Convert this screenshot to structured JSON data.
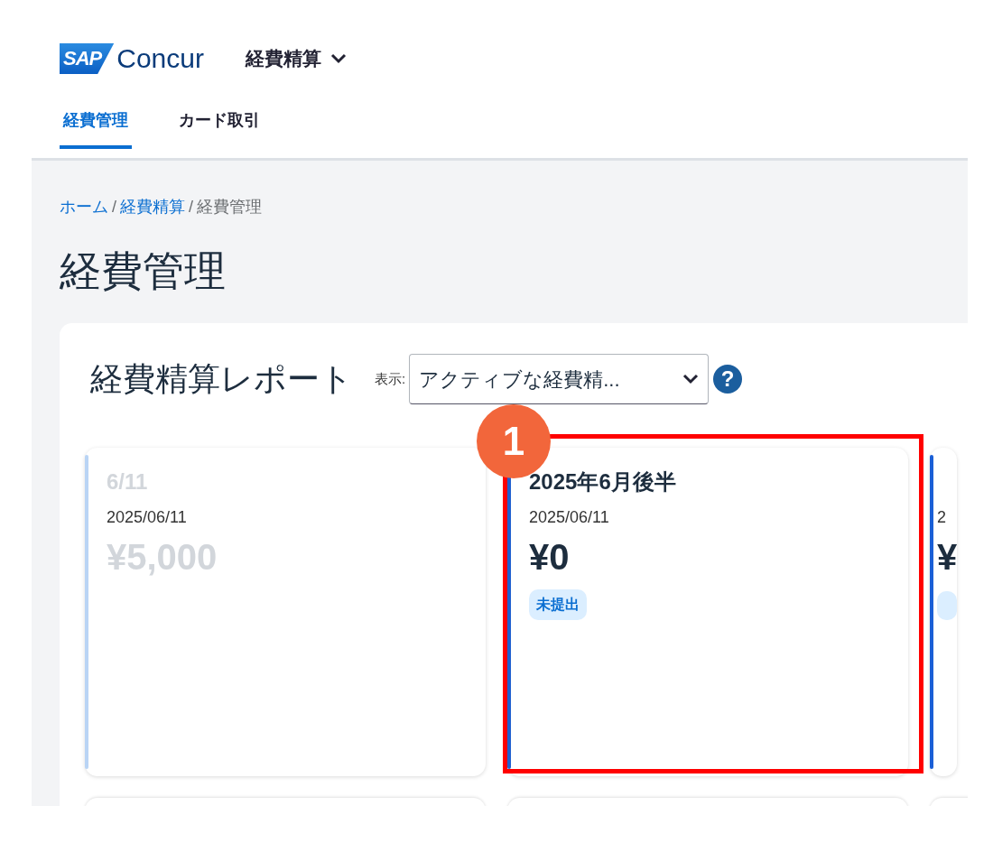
{
  "header": {
    "logo_mark": "SAP",
    "logo_text": "Concur",
    "app_menu": {
      "label": "経費精算",
      "expanded": false
    }
  },
  "tabs": [
    {
      "label": "経費管理",
      "selected": true
    },
    {
      "label": "カード取引",
      "selected": false
    }
  ],
  "breadcrumb": [
    {
      "kind": "link",
      "label": "ホーム"
    },
    {
      "kind": "separator",
      "label": "/"
    },
    {
      "kind": "link",
      "label": "経費精算"
    },
    {
      "kind": "separator",
      "label": "/"
    },
    {
      "kind": "current",
      "label": "経費管理"
    }
  ],
  "page_title": "経費管理",
  "reports_panel": {
    "title": "経費精算レポート",
    "filter_label": "表示:",
    "filter_value": "アクティブな経費精...",
    "help": "?",
    "cards": [
      {
        "title": "6/11",
        "date": "2025/06/11",
        "amount": "¥5,000",
        "faded": true,
        "color": "#b9d4f5"
      },
      {
        "title": "2025年6月後半",
        "date": "2025/06/11",
        "amount": "¥0",
        "status": "未提出",
        "faded": false,
        "color": "#2060d0"
      },
      {
        "date": "2",
        "amount": "¥",
        "faded": false,
        "color": "#1a5fd6",
        "status_pill": true
      }
    ]
  },
  "annotation": {
    "number": "1"
  }
}
